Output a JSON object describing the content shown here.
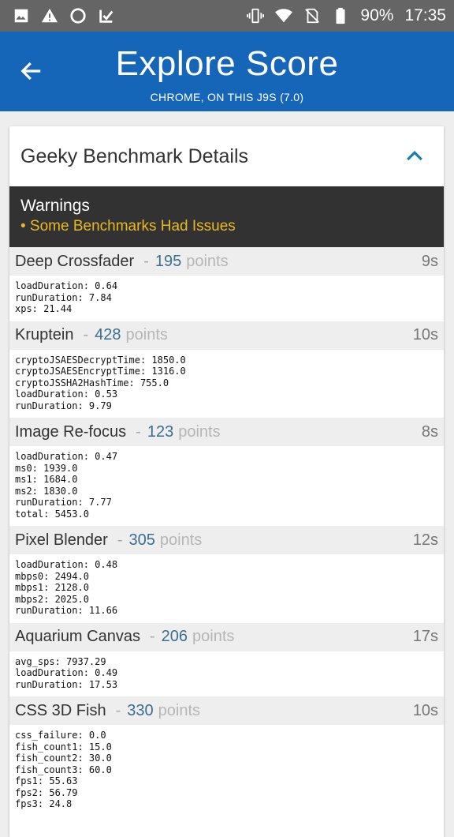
{
  "status_bar": {
    "icons_left": [
      "image-icon",
      "warning-icon",
      "circle-icon",
      "checkmark-icon"
    ],
    "icons_right": [
      "vibrate-icon",
      "wifi-icon",
      "no-sim-icon",
      "battery-icon"
    ],
    "battery": "90%",
    "time": "17:35"
  },
  "app_bar": {
    "title": "Explore Score",
    "subtitle": "CHROME, ON THIS J9S (7.0)"
  },
  "card": {
    "title": "Geeky Benchmark Details",
    "warnings": {
      "title": "Warnings",
      "item": "• Some Benchmarks Had Issues"
    },
    "benchmarks": [
      {
        "name": "Deep Crossfader",
        "score": "195",
        "unit": "points",
        "time": "9s",
        "metrics": [
          "loadDuration: 0.64",
          "runDuration: 7.84",
          "xps: 21.44"
        ]
      },
      {
        "name": "Kruptein",
        "score": "428",
        "unit": "points",
        "time": "10s",
        "metrics": [
          "cryptoJSAESDecryptTime: 1850.0",
          "cryptoJSAESEncryptTime: 1316.0",
          "cryptoJSSHA2HashTime: 755.0",
          "loadDuration: 0.53",
          "runDuration: 9.79"
        ]
      },
      {
        "name": "Image Re-focus",
        "score": "123",
        "unit": "points",
        "time": "8s",
        "metrics": [
          "loadDuration: 0.47",
          "ms0: 1939.0",
          "ms1: 1684.0",
          "ms2: 1830.0",
          "runDuration: 7.77",
          "total: 5453.0"
        ]
      },
      {
        "name": "Pixel Blender",
        "score": "305",
        "unit": "points",
        "time": "12s",
        "metrics": [
          "loadDuration: 0.48",
          "mbps0: 2494.0",
          "mbps1: 2128.0",
          "mbps2: 2025.0",
          "runDuration: 11.66"
        ]
      },
      {
        "name": "Aquarium Canvas",
        "score": "206",
        "unit": "points",
        "time": "17s",
        "metrics": [
          "avg_sps: 7937.29",
          "loadDuration: 0.49",
          "runDuration: 17.53"
        ]
      },
      {
        "name": "CSS 3D Fish",
        "score": "330",
        "unit": "points",
        "time": "10s",
        "metrics": [
          "css_failure: 0.0",
          "fish_count1: 15.0",
          "fish_count2: 30.0",
          "fish_count3: 60.0",
          "fps1: 55.63",
          "fps2: 56.79",
          "fps3: 24.8"
        ]
      }
    ]
  },
  "colors": {
    "app_bar": "#1566b8",
    "status_bar": "#656565",
    "warning_bg": "#323232",
    "warning_text": "#e9b825",
    "score": "#3b6e8f",
    "chevron": "#1a7fb0"
  }
}
